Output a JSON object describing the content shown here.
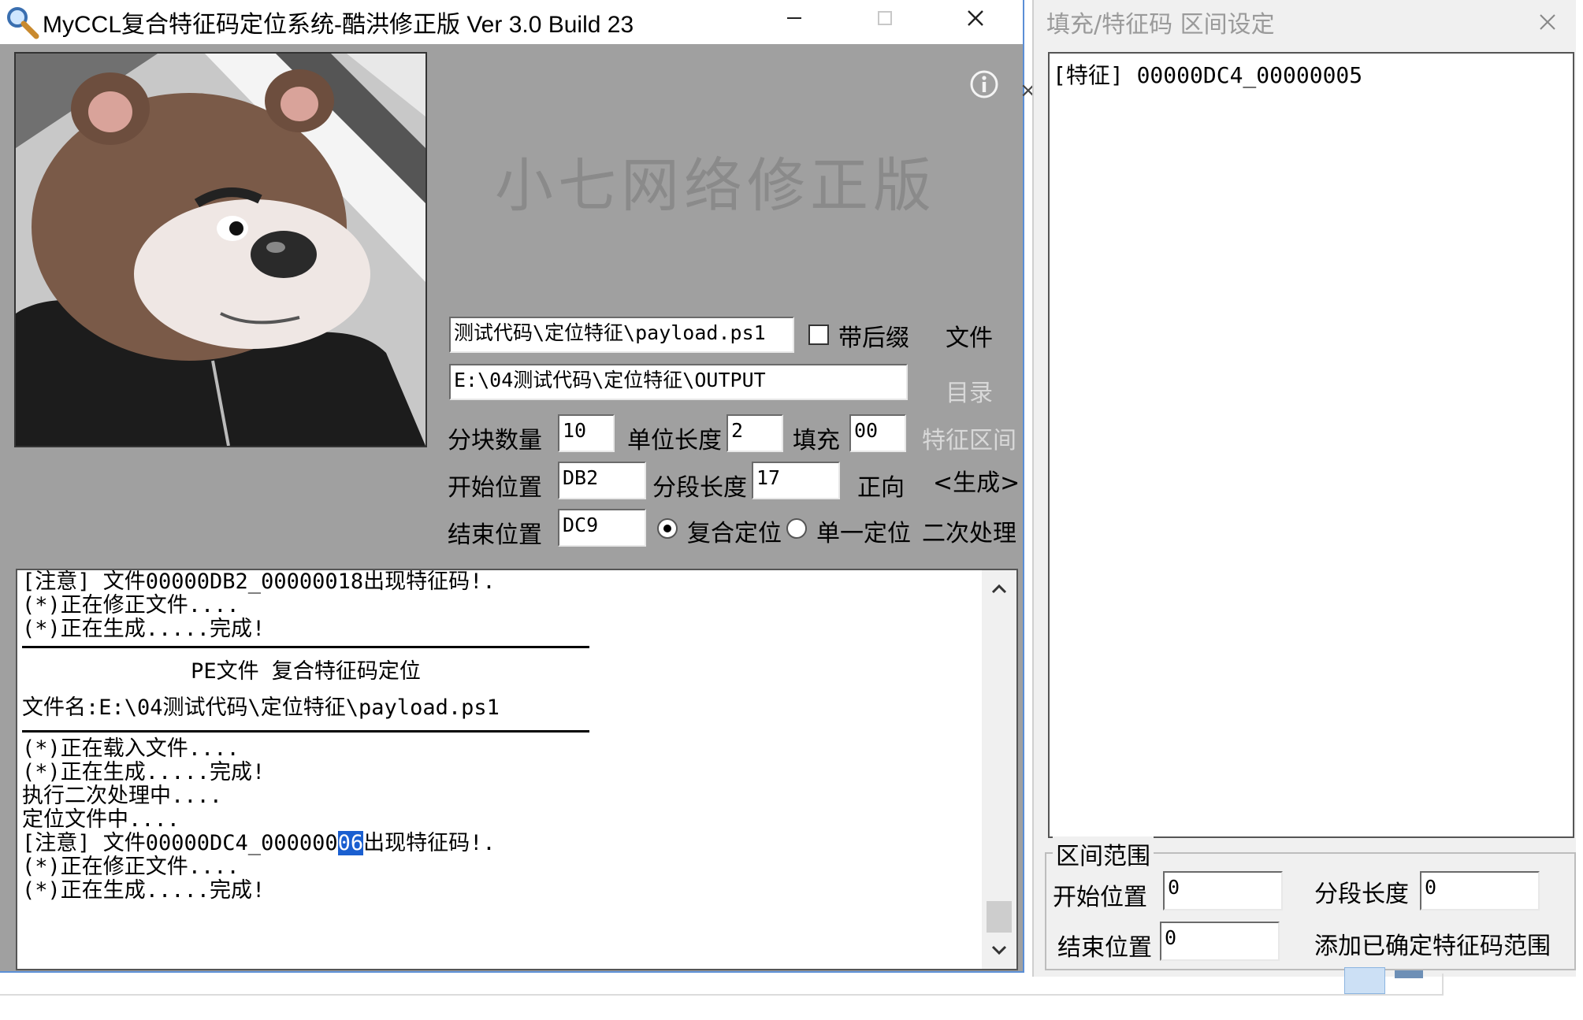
{
  "main_window": {
    "title": "MyCCL复合特征码定位系统-酷洪修正版  Ver 3.0  Build 23",
    "brand_text": "小七网络修正版",
    "file_path": "测试代码\\定位特征\\payload.ps1",
    "with_suffix_label": "带后缀",
    "file_button": "文件",
    "output_dir": "E:\\04测试代码\\定位特征\\OUTPUT",
    "dir_button": "目录",
    "block_count_label": "分块数量",
    "block_count_value": "10",
    "unit_length_label": "单位长度",
    "unit_length_value": "2",
    "fill_label": "填充",
    "fill_value": "00",
    "feature_range_button": "特征区间",
    "start_pos_label": "开始位置",
    "start_pos_value": "DB2",
    "segment_length_label": "分段长度",
    "segment_length_value": "17",
    "forward_button": "正向",
    "generate_button": "<生成>",
    "end_pos_label": "结束位置",
    "end_pos_value": "DC9",
    "composite_label": "复合定位",
    "single_label": "单一定位",
    "secondary_button": "二次处理",
    "log": {
      "line1": "[注意] 文件00000DB2_00000018出现特征码!.",
      "line2": "(*)正在修正文件....",
      "line3": "(*)正在生成.....完成!",
      "header": "PE文件 复合特征码定位",
      "filename": "文件名:E:\\04测试代码\\定位特征\\payload.ps1",
      "line4": "(*)正在载入文件....",
      "line5": "(*)正在生成.....完成!",
      "line6": "执行二次处理中....",
      "line7": "定位文件中....",
      "line8_pre": "[注意] 文件00000DC4_000000",
      "line8_hl": "06",
      "line8_post": "出现特征码!.",
      "line9": "(*)正在修正文件....",
      "line10": "(*)正在生成.....完成!"
    }
  },
  "side_panel": {
    "title": "填充/特征码 区间设定",
    "list_item": "[特征] 00000DC4_00000005",
    "group_label": "区间范围",
    "start_label": "开始位置",
    "start_value": "0",
    "segment_label": "分段长度",
    "segment_value": "0",
    "end_label": "结束位置",
    "end_value": "0",
    "add_button": "添加已确定特征码范围"
  },
  "colors": {
    "dialog_gray": "#a0a0a0",
    "highlight": "#1a5fd0",
    "window_border": "#5b8fd6"
  }
}
